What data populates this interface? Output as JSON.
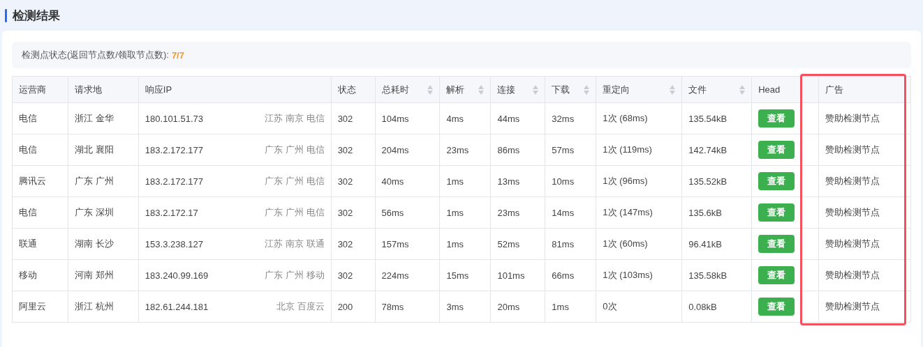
{
  "section_title": "检测结果",
  "summary": {
    "label": "检测点状态(返回节点数/领取节点数):",
    "value": "7/7"
  },
  "table": {
    "columns": [
      {
        "label": "运营商",
        "sortable": false
      },
      {
        "label": "请求地",
        "sortable": false
      },
      {
        "label": "响应IP",
        "sortable": false
      },
      {
        "label": "状态",
        "sortable": false
      },
      {
        "label": "总耗时",
        "sortable": true
      },
      {
        "label": "解析",
        "sortable": true
      },
      {
        "label": "连接",
        "sortable": true
      },
      {
        "label": "下载",
        "sortable": true
      },
      {
        "label": "重定向",
        "sortable": true
      },
      {
        "label": "文件",
        "sortable": true
      },
      {
        "label": "Head",
        "sortable": false
      },
      {
        "label": "广告",
        "sortable": false
      }
    ],
    "rows": [
      {
        "isp": "电信",
        "origin": "浙江 金华",
        "ip": "180.101.51.73",
        "ip_location": "江苏 南京 电信",
        "status": "302",
        "total": "104ms",
        "dns": "4ms",
        "connect": "44ms",
        "download": "32ms",
        "redirect": "1次 (68ms)",
        "file": "135.54kB",
        "head_button": "查看",
        "ad": "赞助检测节点"
      },
      {
        "isp": "电信",
        "origin": "湖北 襄阳",
        "ip": "183.2.172.177",
        "ip_location": "广东 广州 电信",
        "status": "302",
        "total": "204ms",
        "dns": "23ms",
        "connect": "86ms",
        "download": "57ms",
        "redirect": "1次 (119ms)",
        "file": "142.74kB",
        "head_button": "查看",
        "ad": "赞助检测节点"
      },
      {
        "isp": "腾讯云",
        "origin": "广东 广州",
        "ip": "183.2.172.177",
        "ip_location": "广东 广州 电信",
        "status": "302",
        "total": "40ms",
        "dns": "1ms",
        "connect": "13ms",
        "download": "10ms",
        "redirect": "1次 (96ms)",
        "file": "135.52kB",
        "head_button": "查看",
        "ad": "赞助检测节点"
      },
      {
        "isp": "电信",
        "origin": "广东 深圳",
        "ip": "183.2.172.17",
        "ip_location": "广东 广州 电信",
        "status": "302",
        "total": "56ms",
        "dns": "1ms",
        "connect": "23ms",
        "download": "14ms",
        "redirect": "1次 (147ms)",
        "file": "135.6kB",
        "head_button": "查看",
        "ad": "赞助检测节点"
      },
      {
        "isp": "联通",
        "origin": "湖南 长沙",
        "ip": "153.3.238.127",
        "ip_location": "江苏 南京 联通",
        "status": "302",
        "total": "157ms",
        "dns": "1ms",
        "connect": "52ms",
        "download": "81ms",
        "redirect": "1次 (60ms)",
        "file": "96.41kB",
        "head_button": "查看",
        "ad": "赞助检测节点"
      },
      {
        "isp": "移动",
        "origin": "河南 郑州",
        "ip": "183.240.99.169",
        "ip_location": "广东 广州 移动",
        "status": "302",
        "total": "224ms",
        "dns": "15ms",
        "connect": "101ms",
        "download": "66ms",
        "redirect": "1次 (103ms)",
        "file": "135.58kB",
        "head_button": "查看",
        "ad": "赞助检测节点"
      },
      {
        "isp": "阿里云",
        "origin": "浙江 杭州",
        "ip": "182.61.244.181",
        "ip_location": "北京 百度云",
        "status": "200",
        "total": "78ms",
        "dns": "3ms",
        "connect": "20ms",
        "download": "1ms",
        "redirect": "0次",
        "file": "0.08kB",
        "head_button": "查看",
        "ad": "赞助检测节点"
      }
    ]
  }
}
